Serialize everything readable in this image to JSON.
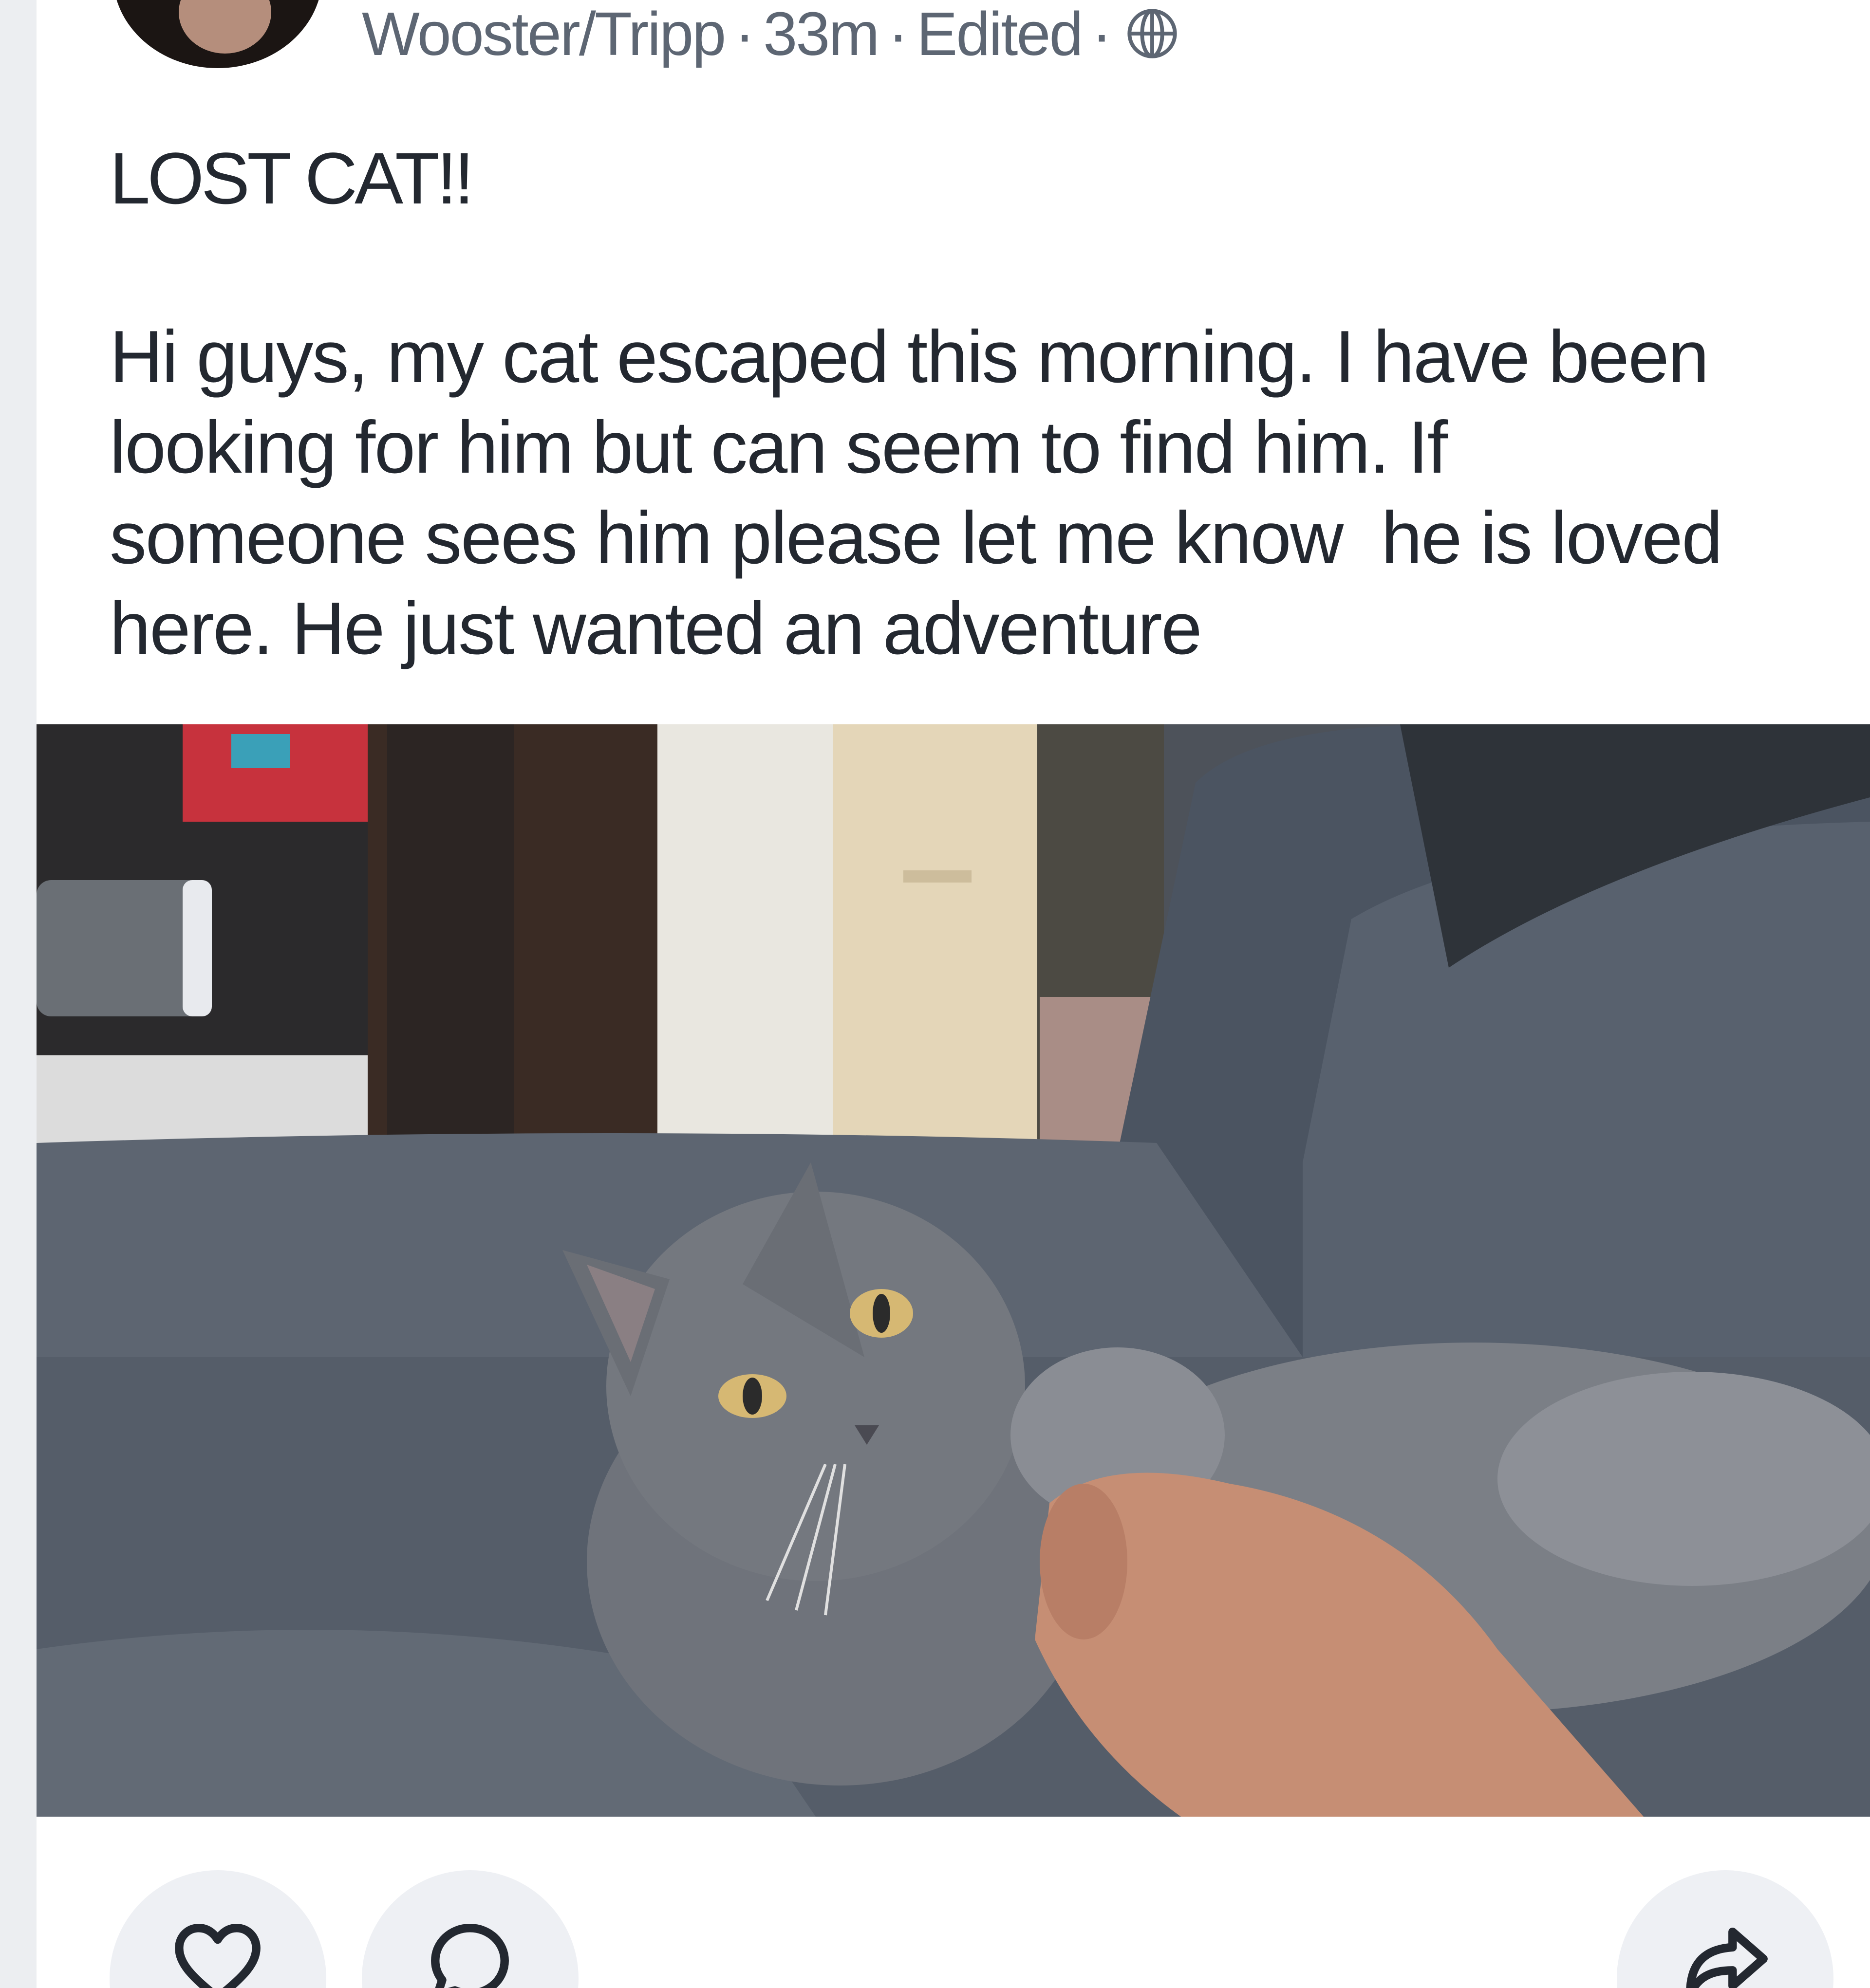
{
  "post": {
    "author_location": "Wooster/Tripp",
    "separator": "·",
    "time_ago": "33m",
    "edited_label": "Edited",
    "visibility_icon": "globe-icon",
    "title": "LOST CAT!!",
    "body_lines": [
      "Hi guys, my cat escaped this morning. I have been",
      "looking for him but can seem to find him. If",
      "someone sees him please let me know  he is loved",
      "here. He just wanted an adventure"
    ],
    "photo_subject": "gray kitten on couch"
  },
  "actions": {
    "like_icon": "heart-icon",
    "comment_icon": "comment-icon",
    "share_icon": "share-icon"
  },
  "colors": {
    "meta_text": "#5d6673",
    "body_text": "#232830",
    "button_bg": "#eef0f4",
    "page_bg": "#eceef1"
  }
}
